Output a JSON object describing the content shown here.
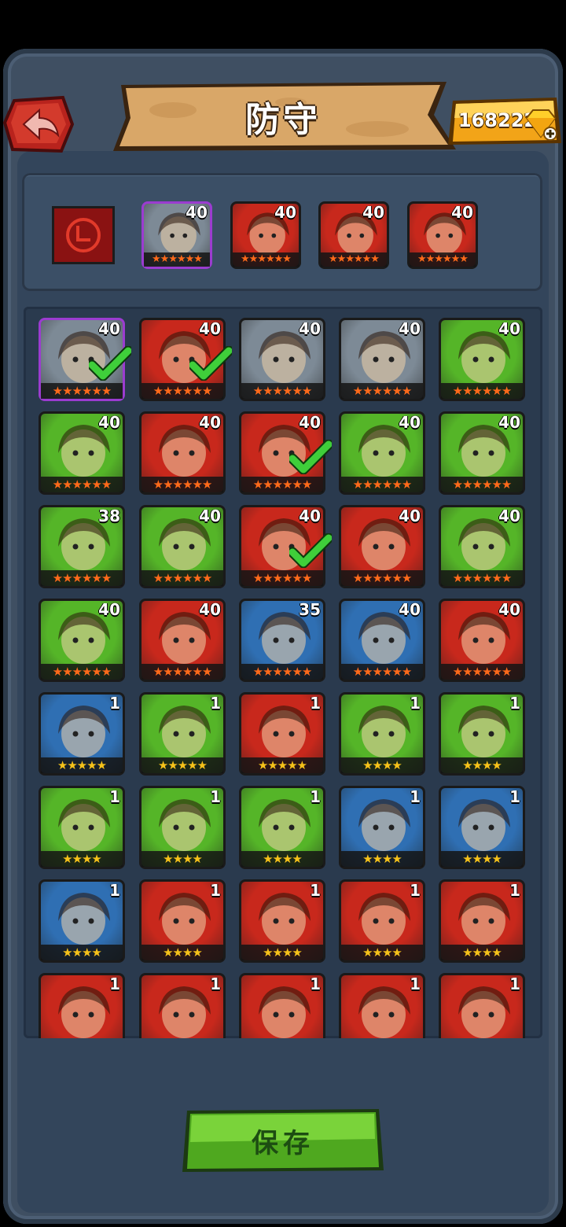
{
  "header": {
    "title": "防守",
    "gems": "168222",
    "back_icon": "back-arrow-icon",
    "gem_icon": "diamond-icon"
  },
  "colors": {
    "red_bg": "#c8281c",
    "green_bg": "#55b528",
    "blue_bg": "#2f6fb3",
    "gray_bg": "#7d8a96",
    "purple_border": "#9b3cd0",
    "star_gold": "#f6c21a",
    "star_orange": "#ff6a1a",
    "check_green": "#3fcf3a",
    "save_green": "#55c023"
  },
  "lineup": {
    "formation_icon": "formation-target-icon",
    "heroes": [
      {
        "level": "40",
        "stars": "★★★★★★",
        "bg": "gray",
        "portrait": "dwarf-warrior-portrait",
        "purple": true
      },
      {
        "level": "40",
        "stars": "★★★★★★",
        "bg": "red",
        "portrait": "hooded-skull-portrait"
      },
      {
        "level": "40",
        "stars": "★★★★★★",
        "bg": "red",
        "portrait": "hooded-skull-portrait"
      },
      {
        "level": "40",
        "stars": "★★★★★★",
        "bg": "red",
        "portrait": "red-hair-heroine-portrait"
      }
    ]
  },
  "roster": [
    {
      "level": "40",
      "stars": "★★★★★★",
      "bg": "gray",
      "portrait": "dwarf-warrior-portrait",
      "purple": true,
      "check": true
    },
    {
      "level": "40",
      "stars": "★★★★★★",
      "bg": "red",
      "portrait": "hooded-skull-portrait",
      "check": true
    },
    {
      "level": "40",
      "stars": "★★★★★★",
      "bg": "gray",
      "portrait": "dwarf-warrior-portrait"
    },
    {
      "level": "40",
      "stars": "★★★★★★",
      "bg": "gray",
      "portrait": "dwarf-warrior-portrait"
    },
    {
      "level": "40",
      "stars": "★★★★★★",
      "bg": "green",
      "portrait": "frog-beast-portrait"
    },
    {
      "level": "40",
      "stars": "★★★★★★",
      "bg": "green",
      "portrait": "goblin-witch-portrait"
    },
    {
      "level": "40",
      "stars": "★★★★★★",
      "bg": "red",
      "portrait": "orc-tusk-portrait"
    },
    {
      "level": "40",
      "stars": "★★★★★★",
      "bg": "red",
      "portrait": "red-hair-heroine-portrait",
      "check": true
    },
    {
      "level": "40",
      "stars": "★★★★★★",
      "bg": "green",
      "portrait": "orc-tusk-portrait"
    },
    {
      "level": "40",
      "stars": "★★★★★★",
      "bg": "green",
      "portrait": "bandana-warrior-portrait"
    },
    {
      "level": "38",
      "stars": "★★★★★★",
      "bg": "green",
      "portrait": "skull-hat-heroine-portrait"
    },
    {
      "level": "40",
      "stars": "★★★★★★",
      "bg": "green",
      "portrait": "tree-spirit-portrait"
    },
    {
      "level": "40",
      "stars": "★★★★★★",
      "bg": "red",
      "portrait": "hooded-skull-portrait",
      "check": true
    },
    {
      "level": "40",
      "stars": "★★★★★★",
      "bg": "red",
      "portrait": "fire-fox-portrait"
    },
    {
      "level": "40",
      "stars": "★★★★★★",
      "bg": "green",
      "portrait": "skull-helm-heroine-portrait"
    },
    {
      "level": "40",
      "stars": "★★★★★★",
      "bg": "green",
      "portrait": "dwarf-warrior-portrait"
    },
    {
      "level": "40",
      "stars": "★★★★★★",
      "bg": "red",
      "portrait": "horned-shaman-portrait"
    },
    {
      "level": "35",
      "stars": "★★★★★★",
      "bg": "blue",
      "portrait": "blue-hair-portrait"
    },
    {
      "level": "40",
      "stars": "★★★★★★",
      "bg": "blue",
      "portrait": "white-hood-heroine-portrait"
    },
    {
      "level": "40",
      "stars": "★★★★★★",
      "bg": "red",
      "portrait": "panda-portrait"
    },
    {
      "level": "1",
      "stars": "★★★★★",
      "bg": "blue",
      "portrait": "horned-beast-portrait"
    },
    {
      "level": "1",
      "stars": "★★★★★",
      "bg": "green",
      "portrait": "masked-orc-portrait"
    },
    {
      "level": "1",
      "stars": "★★★★★",
      "bg": "red",
      "portrait": "braided-heroine-portrait"
    },
    {
      "level": "1",
      "stars": "★★★★",
      "bg": "green",
      "portrait": "leaf-lion-portrait"
    },
    {
      "level": "1",
      "stars": "★★★★",
      "bg": "green",
      "portrait": "leaf-lion-portrait"
    },
    {
      "level": "1",
      "stars": "★★★★",
      "bg": "green",
      "portrait": "leaf-lion-portrait"
    },
    {
      "level": "1",
      "stars": "★★★★",
      "bg": "green",
      "portrait": "elf-heroine-portrait"
    },
    {
      "level": "1",
      "stars": "★★★★",
      "bg": "green",
      "portrait": "dark-hair-heroine-portrait"
    },
    {
      "level": "1",
      "stars": "★★★★",
      "bg": "blue",
      "portrait": "wolf-beast-portrait"
    },
    {
      "level": "1",
      "stars": "★★★★",
      "bg": "blue",
      "portrait": "blue-hat-goblin-portrait"
    },
    {
      "level": "1",
      "stars": "★★★★",
      "bg": "blue",
      "portrait": "blue-hair-heroine-portrait"
    },
    {
      "level": "1",
      "stars": "★★★★",
      "bg": "red",
      "portrait": "fire-lion-portrait"
    },
    {
      "level": "1",
      "stars": "★★★★",
      "bg": "red",
      "portrait": "fire-lion-portrait"
    },
    {
      "level": "1",
      "stars": "★★★★",
      "bg": "red",
      "portrait": "fire-lion-portrait"
    },
    {
      "level": "1",
      "stars": "★★★★",
      "bg": "red",
      "portrait": "horned-shaman-portrait"
    },
    {
      "level": "1",
      "stars": "★★★★",
      "bg": "red",
      "portrait": "horned-shaman-portrait"
    },
    {
      "level": "1",
      "stars": "★★★★",
      "bg": "red",
      "portrait": "horned-shaman-portrait"
    },
    {
      "level": "1",
      "stars": "★★★★",
      "bg": "red",
      "portrait": "long-hair-warrior-portrait"
    },
    {
      "level": "1",
      "stars": "★★★★",
      "bg": "red",
      "portrait": "red-wolf-portrait"
    },
    {
      "level": "1",
      "stars": "★★★★",
      "bg": "red",
      "portrait": "red-wolf-portrait"
    }
  ],
  "footer": {
    "save_label": "保存"
  }
}
